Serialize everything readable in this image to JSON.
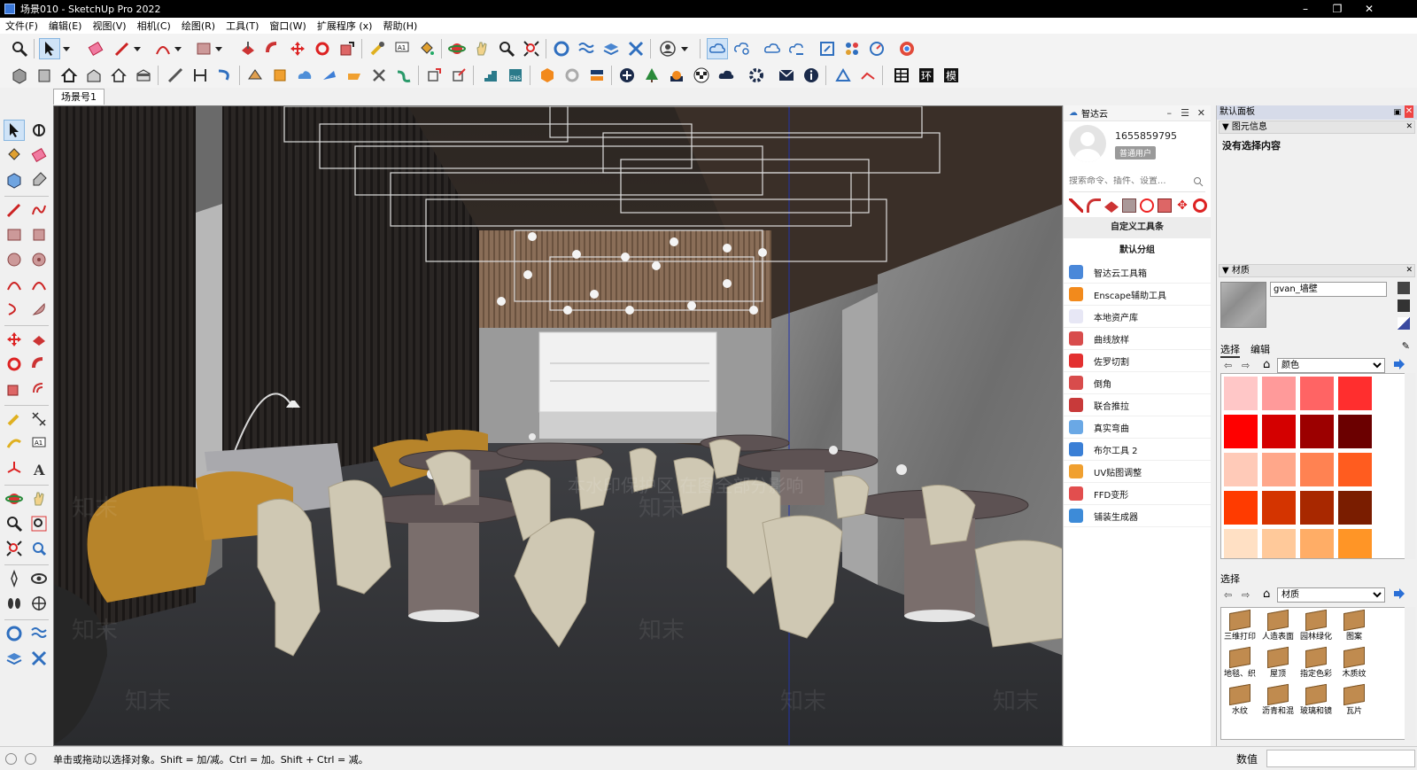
{
  "window": {
    "title": "场景010 - SketchUp Pro 2022",
    "minimize": "–",
    "maximize": "❐",
    "close": "✕"
  },
  "menu": [
    "文件(F)",
    "编辑(E)",
    "视图(V)",
    "相机(C)",
    "绘图(R)",
    "工具(T)",
    "窗口(W)",
    "扩展程序 (x)",
    "帮助(H)"
  ],
  "scene_tabs": [
    "场景号1"
  ],
  "cloud_panel": {
    "title": "智达云",
    "user_id": "1655859795",
    "user_level": "普通用户",
    "search_placeholder": "搜索命令、插件、设置...",
    "custom_toolbar": "自定义工具条",
    "default_group": "默认分组",
    "items": [
      "智达云工具箱",
      "Enscape辅助工具",
      "本地资产库",
      "曲线放样",
      "佐罗切割",
      "倒角",
      "联合推拉",
      "真实弯曲",
      "布尔工具 2",
      "UV贴图调整",
      "FFD变形",
      "铺装生成器"
    ],
    "item_colors": [
      "#4a88d9",
      "#f28a1c",
      "#e7e7f5",
      "#d84c4c",
      "#e33030",
      "#d84c4c",
      "#c83a3a",
      "#6aa8e5",
      "#3a7fd6",
      "#f0a030",
      "#e24e4e",
      "#3d8bd8"
    ]
  },
  "tray": {
    "title": "默认面板",
    "entity_info": {
      "title": "图元信息",
      "value": "没有选择内容"
    },
    "materials": {
      "title": "材质",
      "current_name": "gvan_墙壁",
      "tab_select": "选择",
      "tab_edit": "编辑",
      "library": "颜色",
      "bottom_label": "选择",
      "bottom_library": "材质",
      "colors": [
        "#ffc7c7",
        "#ff9a9a",
        "#ff6464",
        "#ff2e2e",
        "#ff0000",
        "#d40000",
        "#9c0000",
        "#6b0000",
        "#ffcab8",
        "#ffa78a",
        "#ff8252",
        "#ff5c1f",
        "#ff3b00",
        "#d43400",
        "#a82800",
        "#7a1d00",
        "#ffe0c4",
        "#ffc99a",
        "#ffad66",
        "#ff9526"
      ],
      "folders": [
        "三维打印",
        "人造表面",
        "园林绿化",
        "图案",
        "地毯、织",
        "屋顶",
        "指定色彩",
        "木质纹",
        "水纹",
        "沥青和混",
        "玻璃和镜",
        "瓦片"
      ]
    }
  },
  "status": {
    "hint": "单击或拖动以选择对象。Shift = 加/减。Ctrl = 加。Shift + Ctrl = 减。",
    "vcb_label": "数值"
  },
  "viewport": {
    "watermark": "知末",
    "protect_text": "本水印保护区 在图全部分影响"
  }
}
